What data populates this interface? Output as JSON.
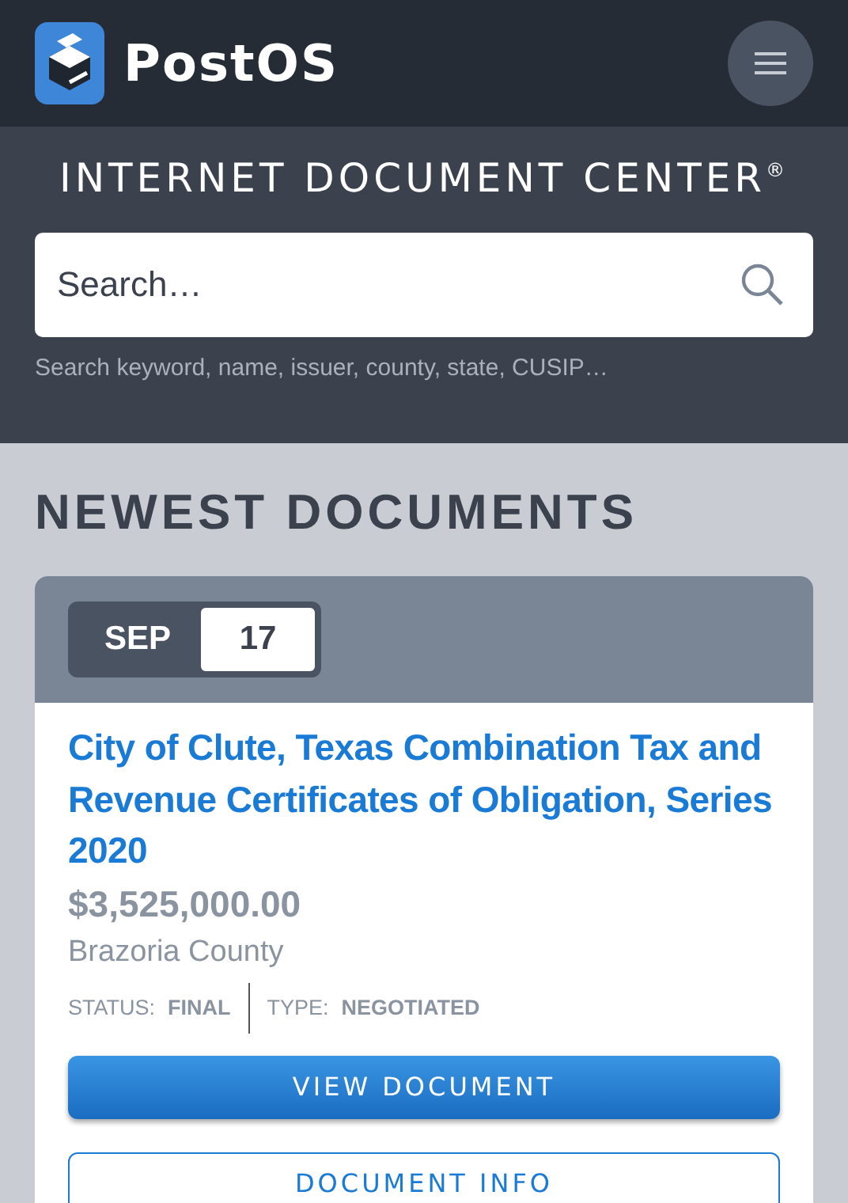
{
  "header": {
    "brand": "PostOS"
  },
  "banner": {
    "title": "INTERNET DOCUMENT CENTER$^{®}$",
    "search": {
      "placeholder": "Search…"
    },
    "hint": "Search keyword, name, issuer, county, state, CUSIP…"
  },
  "section_title": "NEWEST DOCUMENTS",
  "documents": [
    {
      "month": "SEP",
      "day": "17",
      "title": "City of Clute, Texas Combination Tax and Revenue Certificates of Obligation, Series 2020",
      "amount": "$3,525,000.00",
      "county": "Brazoria County",
      "status_label": "STATUS:",
      "status": "FINAL",
      "type_label": "TYPE:",
      "type": "NEGOTIATED",
      "buttons": [
        "VIEW DOCUMENT",
        "DOCUMENT INFO"
      ]
    }
  ]
}
